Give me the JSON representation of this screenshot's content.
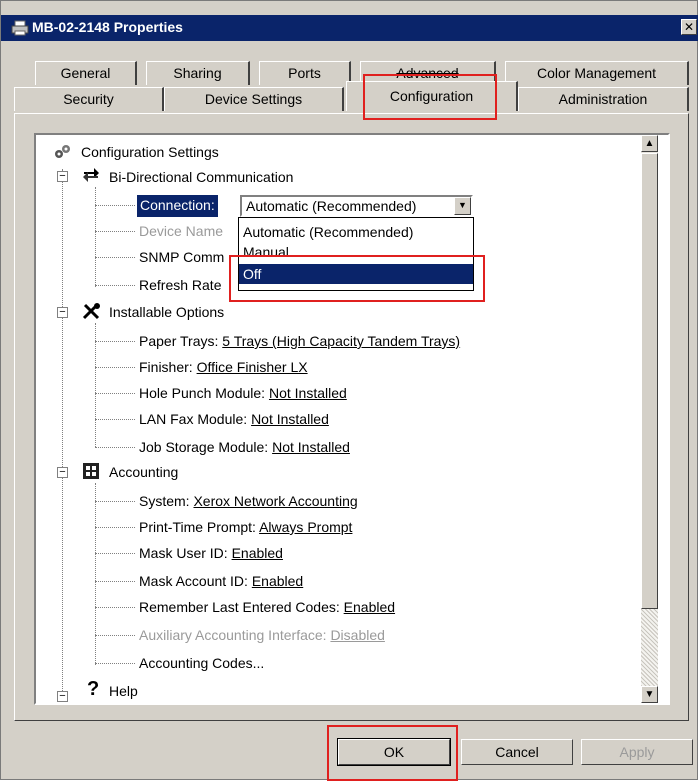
{
  "window": {
    "title": "MB-02-2148 Properties",
    "close_glyph": "✕"
  },
  "tabs": {
    "row1": [
      "General",
      "Sharing",
      "Ports",
      "Advanced",
      "Color Management"
    ],
    "row2": [
      "Security",
      "Device Settings",
      "Configuration",
      "Administration"
    ],
    "active": "Configuration"
  },
  "tree": {
    "root": "Configuration Settings",
    "bidi": {
      "label": "Bi-Directional Communication",
      "connection_label": "Connection:",
      "connection_value": "Automatic (Recommended)",
      "device_name_label": "Device Name",
      "snmp_label": "SNMP Comm",
      "refresh_label": "Refresh Rate"
    },
    "dropdown_options": [
      "Automatic (Recommended)",
      "Manual",
      "Off"
    ],
    "dropdown_selected": "Off",
    "installable": {
      "label": "Installable Options",
      "items": [
        {
          "label": "Paper Trays:",
          "value": "5 Trays (High Capacity Tandem Trays)"
        },
        {
          "label": "Finisher:",
          "value": "Office Finisher LX"
        },
        {
          "label": "Hole Punch Module:",
          "value": "Not Installed"
        },
        {
          "label": "LAN Fax Module:",
          "value": "Not Installed"
        },
        {
          "label": "Job Storage Module:",
          "value": "Not Installed"
        }
      ]
    },
    "accounting": {
      "label": "Accounting",
      "items": [
        {
          "label": "System:",
          "value": "Xerox Network Accounting"
        },
        {
          "label": "Print-Time Prompt:",
          "value": "Always Prompt"
        },
        {
          "label": "Mask User ID:",
          "value": "Enabled"
        },
        {
          "label": "Mask Account ID:",
          "value": "Enabled"
        },
        {
          "label": "Remember Last Entered Codes:",
          "value": "Enabled"
        },
        {
          "label": "Auxiliary Accounting Interface:",
          "value": "Disabled"
        },
        {
          "label": "Accounting Codes...",
          "value": ""
        }
      ]
    },
    "help": {
      "label": "Help"
    }
  },
  "buttons": {
    "ok": "OK",
    "cancel": "Cancel",
    "apply": "Apply"
  },
  "colors": {
    "title_bar": "#0a246a",
    "selection": "#0a246a",
    "highlight_annotation": "#e0201f",
    "face": "#d4d0c8"
  }
}
